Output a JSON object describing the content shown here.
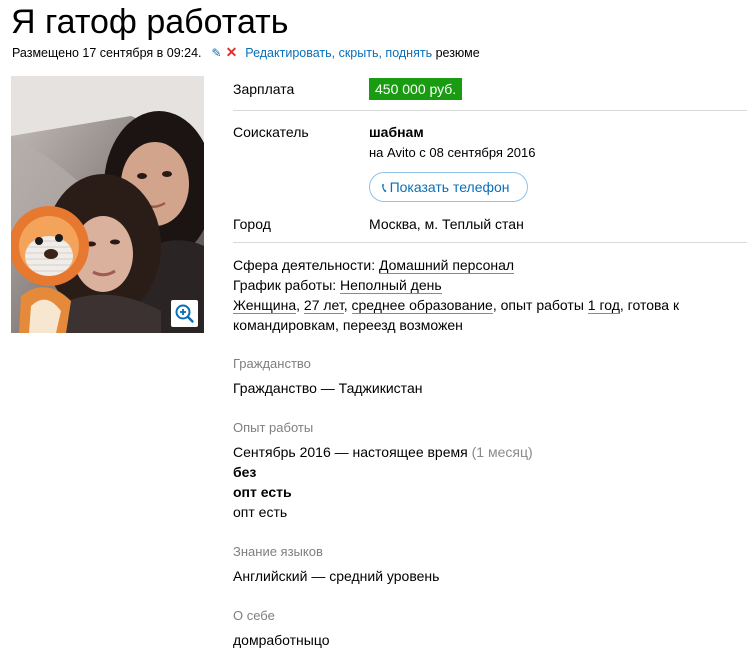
{
  "title": "Я гатоф работать",
  "meta": {
    "posted": "Размещено 17 сентября в 09:24.",
    "edit_links": "Редактировать, скрыть, поднять",
    "suffix": "резюме"
  },
  "details": {
    "salary_label": "Зарплата",
    "salary_value": "450 000 руб.",
    "applicant_label": "Соискатель",
    "applicant_name": "шабнам",
    "applicant_since": "на Avito с 08 сентября 2016",
    "phone_button": "Показать телефон",
    "city_label": "Город",
    "city_value": "Москва, м. Теплый стан"
  },
  "info": {
    "sphere_label": "Сфера деятельности:",
    "sphere_value": "Домашний персонал",
    "schedule_label": "График работы:",
    "schedule_value": "Неполный день",
    "gender": "Женщина",
    "sep1": ",",
    "age": "27 лет",
    "sep2": ",",
    "education": "среднее образование",
    "exp_prefix": ", опыт работы",
    "exp_value": "1 год",
    "rest_line1": ", готова к",
    "rest_line2": "командировкам, переезд возможен"
  },
  "sections": {
    "citizenship_h": "Гражданство",
    "citizenship_t": "Гражданство — Таджикистан",
    "experience_h": "Опыт работы",
    "experience_period": "Сентябрь 2016 — настоящее время",
    "experience_duration": "(1 месяц)",
    "experience_company": "без",
    "experience_position": "опт есть",
    "experience_desc": "опт есть",
    "languages_h": "Знание языков",
    "languages_t": "Английский — средний уровень",
    "about_h": "О себе",
    "about_t": "домработныцо"
  },
  "colors": {
    "link": "#0a6fb8",
    "salary_bg": "#1a9c12",
    "delete": "#e0312f"
  }
}
